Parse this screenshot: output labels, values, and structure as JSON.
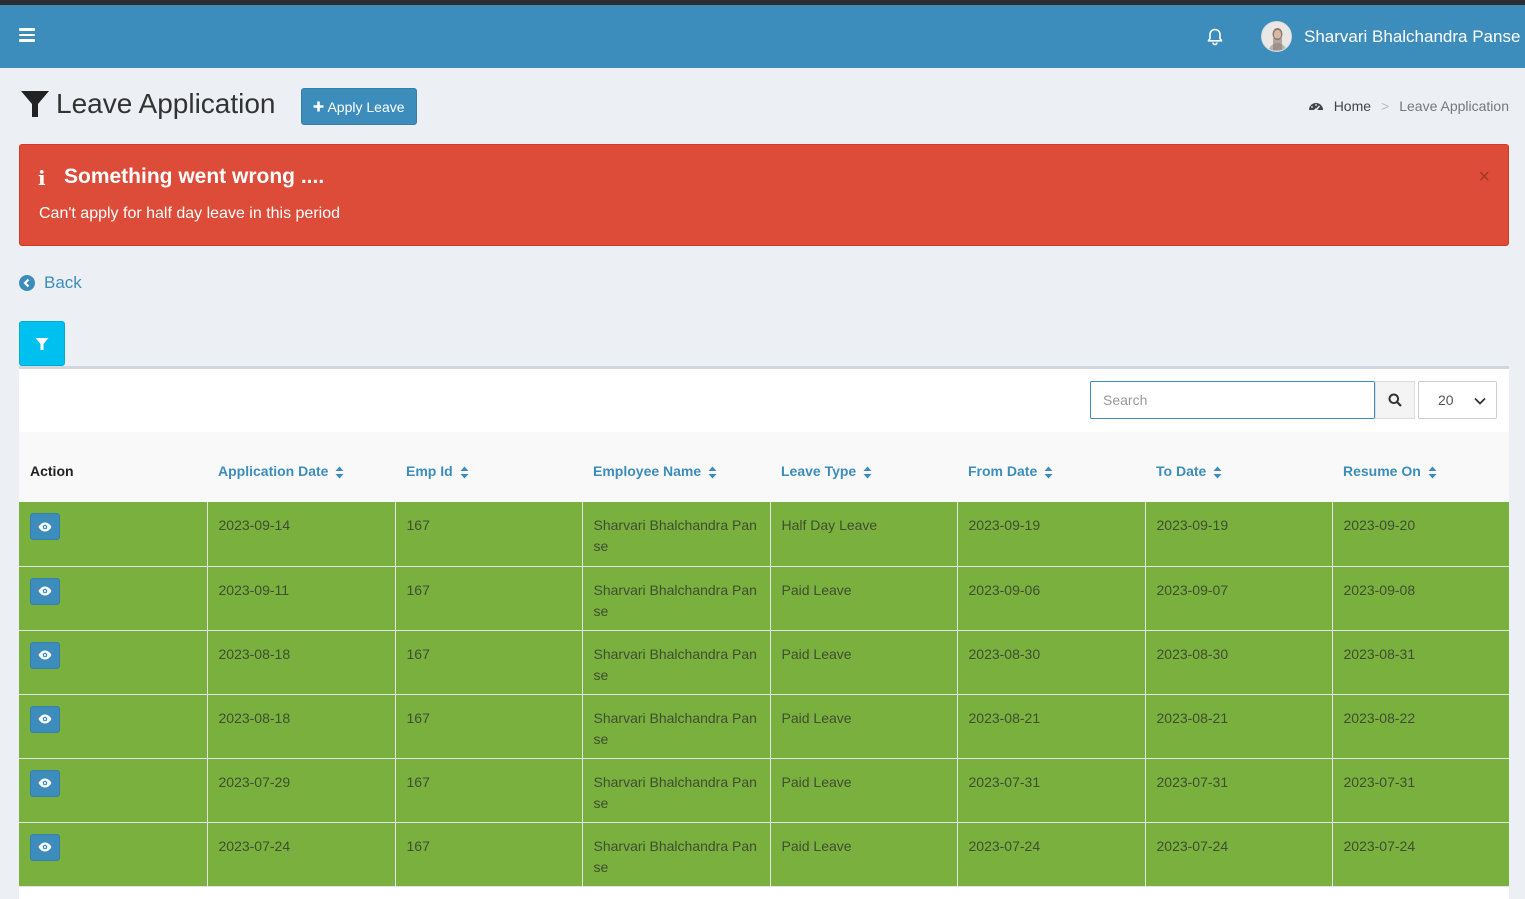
{
  "navbar": {
    "user_name": "Sharvari Bhalchandra Panse",
    "icons": {
      "menu": "bars-icon",
      "notifications": "bell-icon"
    },
    "color": "#3c8dbc"
  },
  "header": {
    "title": "Leave Application",
    "apply_button": "Apply Leave",
    "breadcrumb": {
      "home": "Home",
      "current": "Leave Application"
    }
  },
  "alert": {
    "title": "Something went wrong ....",
    "message": "Can't apply for half day leave in this period",
    "close": "×",
    "color": "#dd4b39"
  },
  "back_label": "Back",
  "search": {
    "placeholder": "Search",
    "value": ""
  },
  "page_size": "20",
  "table": {
    "columns": [
      "Action",
      "Application Date",
      "Emp Id",
      "Employee Name",
      "Leave Type",
      "From Date",
      "To Date",
      "Resume On"
    ],
    "row_color": "#7ab13e",
    "rows": [
      {
        "application_date": "2023-09-14",
        "emp_id": "167",
        "employee_name": "Sharvari Bhalchandra Panse",
        "leave_type": "Half Day Leave",
        "from_date": "2023-09-19",
        "to_date": "2023-09-19",
        "resume_on": "2023-09-20"
      },
      {
        "application_date": "2023-09-11",
        "emp_id": "167",
        "employee_name": "Sharvari Bhalchandra Panse",
        "leave_type": "Paid Leave",
        "from_date": "2023-09-06",
        "to_date": "2023-09-07",
        "resume_on": "2023-09-08"
      },
      {
        "application_date": "2023-08-18",
        "emp_id": "167",
        "employee_name": "Sharvari Bhalchandra Panse",
        "leave_type": "Paid Leave",
        "from_date": "2023-08-30",
        "to_date": "2023-08-30",
        "resume_on": "2023-08-31"
      },
      {
        "application_date": "2023-08-18",
        "emp_id": "167",
        "employee_name": "Sharvari Bhalchandra Panse",
        "leave_type": "Paid Leave",
        "from_date": "2023-08-21",
        "to_date": "2023-08-21",
        "resume_on": "2023-08-22"
      },
      {
        "application_date": "2023-07-29",
        "emp_id": "167",
        "employee_name": "Sharvari Bhalchandra Panse",
        "leave_type": "Paid Leave",
        "from_date": "2023-07-31",
        "to_date": "2023-07-31",
        "resume_on": "2023-07-31"
      },
      {
        "application_date": "2023-07-24",
        "emp_id": "167",
        "employee_name": "Sharvari Bhalchandra Panse",
        "leave_type": "Paid Leave",
        "from_date": "2023-07-24",
        "to_date": "2023-07-24",
        "resume_on": "2023-07-24"
      }
    ]
  }
}
